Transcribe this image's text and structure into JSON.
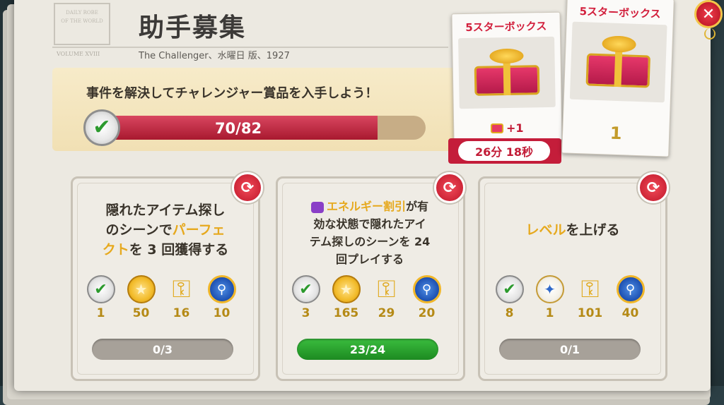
{
  "header": {
    "title": "助手募集",
    "subtitle": "The Challenger、水曜日 版、1927",
    "stamp_lines": [
      "DAILY ROBE",
      "OF THE WORLD"
    ],
    "stamp_footer": "VOLUME XVIII"
  },
  "goal": {
    "text": "事件を解決してチャレンジャー賞品を入手しよう！",
    "progress_current": 70,
    "progress_total": 82,
    "progress_label": "70/82"
  },
  "prizes": {
    "current": {
      "title": "5スターボックス",
      "bonus": "+1",
      "timer": "26分 18秒"
    },
    "next": {
      "title": "5スターボックス",
      "count": "1"
    }
  },
  "tasks": [
    {
      "lines": [
        "隠れたアイテム探し",
        "のシーンで",
        "パーフェ",
        "クト",
        "を 3 回獲得する"
      ],
      "rewards": [
        {
          "icon": "check-badge-icon",
          "value": "1"
        },
        {
          "icon": "coin-icon",
          "value": "50"
        },
        {
          "icon": "wind-up-key-icon",
          "value": "16"
        },
        {
          "icon": "magnifier-badge-icon",
          "value": "10"
        }
      ],
      "progress_label": "0/3",
      "complete": false
    },
    {
      "lines": [
        "エネルギー割引",
        "が有",
        "効な状態で隠れたアイ",
        "テム探しのシーンを 24",
        "回プレイする"
      ],
      "rewards": [
        {
          "icon": "check-badge-icon",
          "value": "3"
        },
        {
          "icon": "coin-icon",
          "value": "165"
        },
        {
          "icon": "wind-up-key-icon",
          "value": "29"
        },
        {
          "icon": "magnifier-badge-icon",
          "value": "20"
        }
      ],
      "progress_label": "23/24",
      "complete": true
    },
    {
      "lines": [
        "レベル",
        "を上げる"
      ],
      "rewards": [
        {
          "icon": "check-badge-icon",
          "value": "8"
        },
        {
          "icon": "compass-icon",
          "value": "1"
        },
        {
          "icon": "wind-up-key-icon",
          "value": "101"
        },
        {
          "icon": "magnifier-badge-icon",
          "value": "40"
        }
      ],
      "progress_label": "0/1",
      "complete": false
    }
  ],
  "colors": {
    "accent_red": "#c41d3a",
    "highlight_gold": "#e6a91e",
    "progress_green": "#1d8a21"
  }
}
